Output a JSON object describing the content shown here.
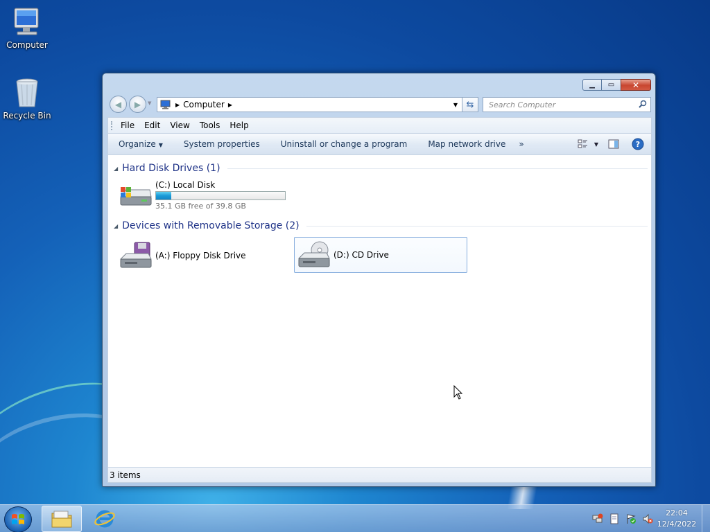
{
  "desktop": {
    "icons": [
      {
        "label": "Computer"
      },
      {
        "label": "Recycle Bin"
      }
    ]
  },
  "window": {
    "address": {
      "segments": [
        "Computer"
      ]
    },
    "search": {
      "placeholder": "Search Computer"
    },
    "menu": [
      "File",
      "Edit",
      "View",
      "Tools",
      "Help"
    ],
    "toolbar": {
      "organize": "Organize",
      "system_properties": "System properties",
      "uninstall": "Uninstall or change a program",
      "map_drive": "Map network drive",
      "more": "»"
    },
    "groups": [
      {
        "title": "Hard Disk Drives (1)",
        "items": [
          {
            "name": "(C:) Local Disk",
            "free_text": "35.1 GB free of 39.8 GB",
            "used_fraction": 0.118
          }
        ]
      },
      {
        "title": "Devices with Removable Storage (2)",
        "items": [
          {
            "name": "(A:) Floppy Disk Drive"
          },
          {
            "name": "(D:) CD Drive"
          }
        ]
      }
    ],
    "status": "3 items"
  },
  "taskbar": {
    "time": "22:04",
    "date": "12/4/2022"
  }
}
